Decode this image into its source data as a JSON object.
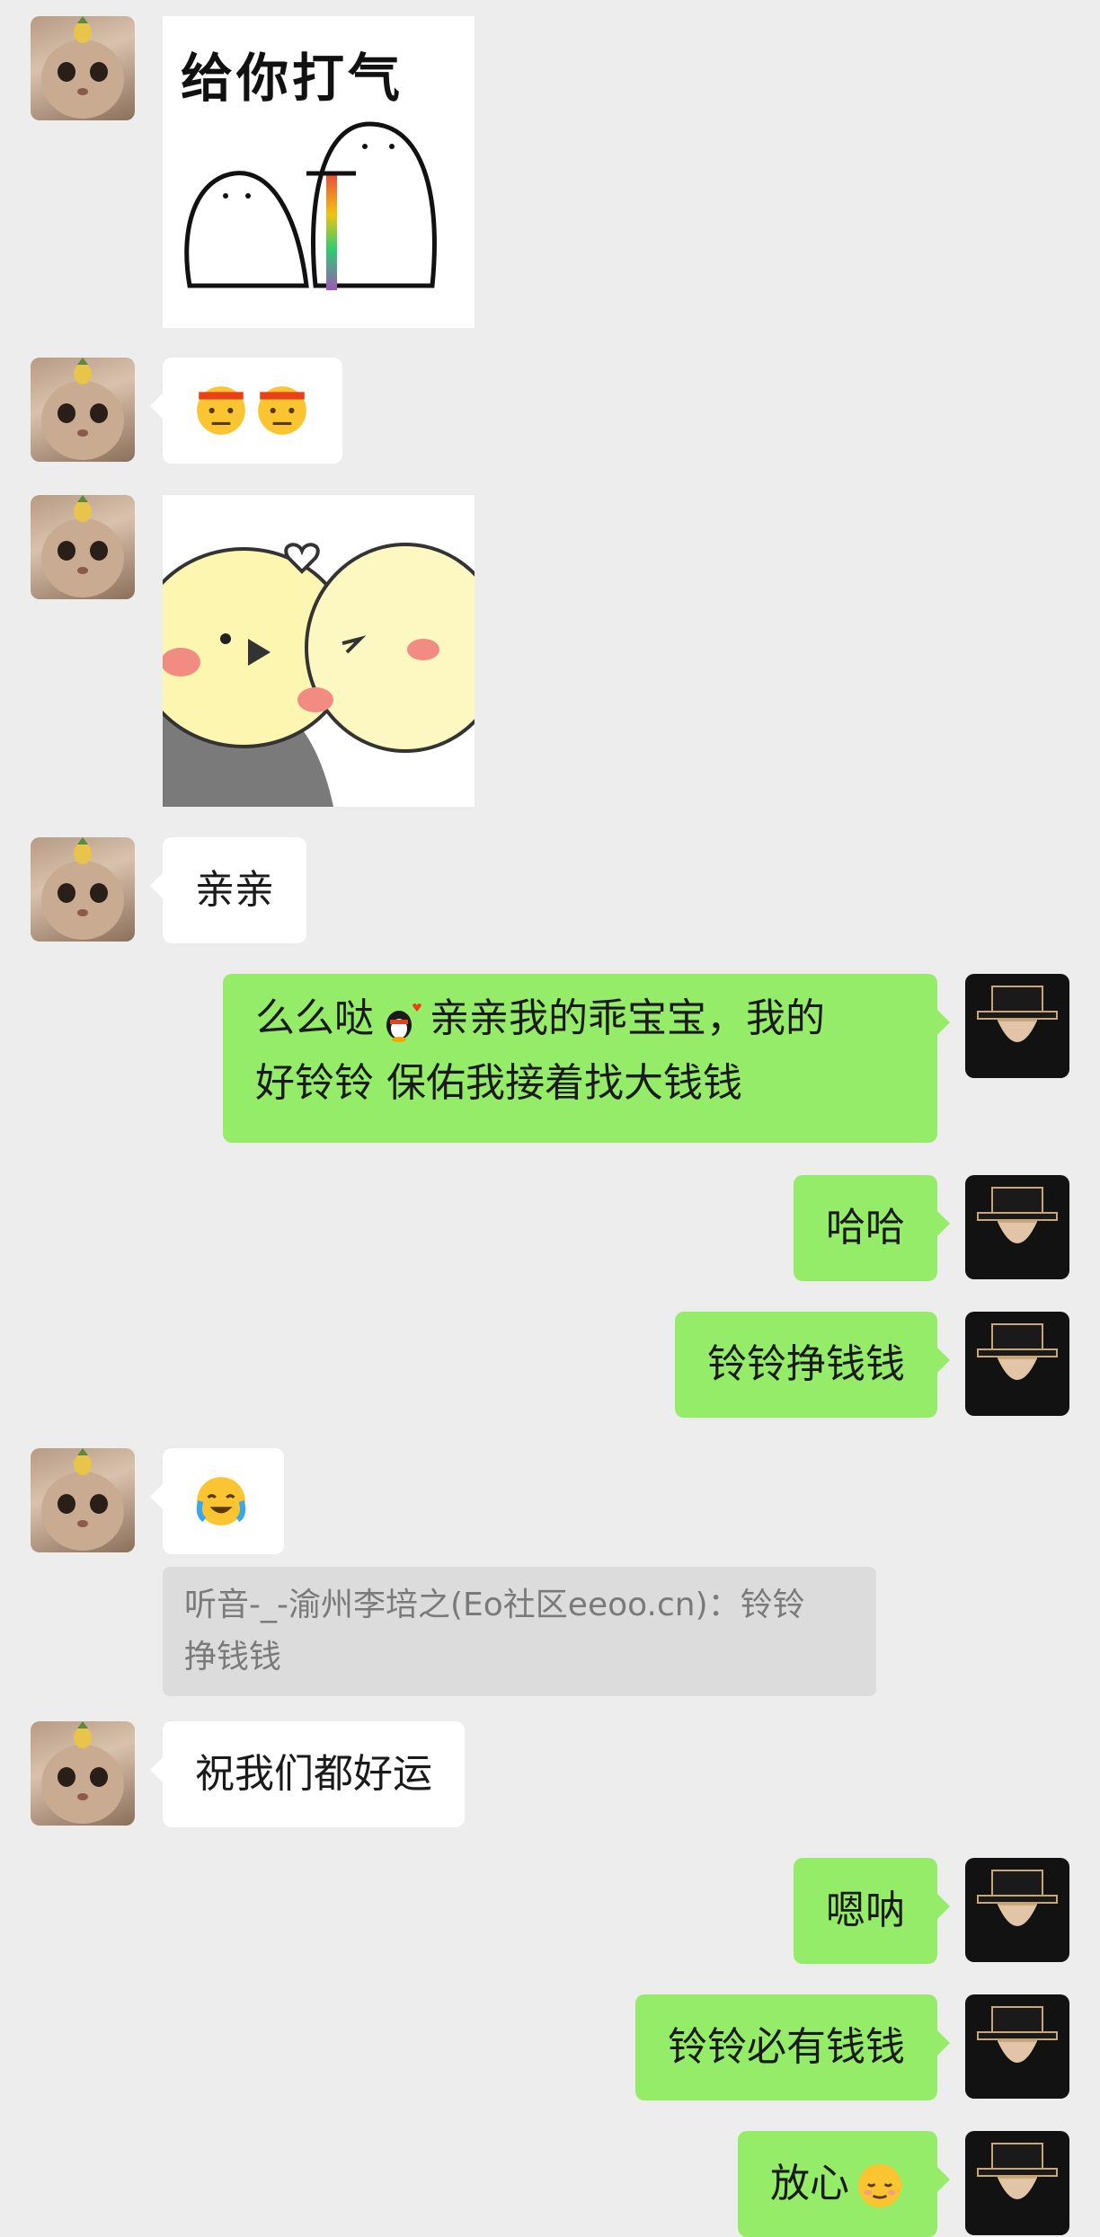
{
  "messages": [
    {
      "side": "left",
      "type": "sticker",
      "sticker_text": "给你打气"
    },
    {
      "side": "left",
      "type": "emoji",
      "emojis": [
        "saluting-face-emoji",
        "saluting-face-emoji"
      ]
    },
    {
      "side": "left",
      "type": "sticker",
      "sticker_text": ""
    },
    {
      "side": "left",
      "type": "text",
      "text": "亲亲"
    },
    {
      "side": "right",
      "type": "text",
      "line1_a": "么么哒",
      "line1_b": "亲亲我的乖宝宝，我的",
      "line2": "好铃铃 保佑我接着找大钱钱"
    },
    {
      "side": "right",
      "type": "text",
      "text": "哈哈"
    },
    {
      "side": "right",
      "type": "text",
      "text": "铃铃挣钱钱"
    },
    {
      "side": "left",
      "type": "emoji",
      "emojis": [
        "crying-laughing-emoji"
      ]
    },
    {
      "side": "left",
      "type": "quote",
      "line1": "听音-_-渝州李培之(Eo社区eeoo.cn)：铃铃",
      "line2": "挣钱钱"
    },
    {
      "side": "left",
      "type": "text",
      "text": "祝我们都好运"
    },
    {
      "side": "right",
      "type": "text",
      "text": "嗯呐"
    },
    {
      "side": "right",
      "type": "text",
      "text": "铃铃必有钱钱"
    },
    {
      "side": "right",
      "type": "text",
      "text": "放心"
    }
  ],
  "colors": {
    "background": "#ededed",
    "bubble_self": "#95ec69",
    "bubble_other": "#ffffff"
  }
}
